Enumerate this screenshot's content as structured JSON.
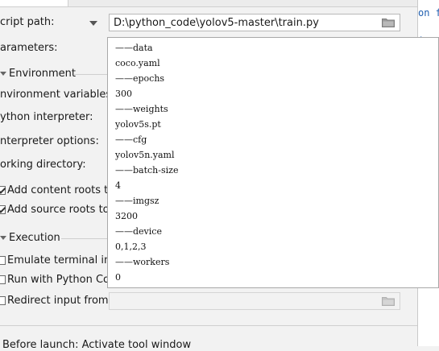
{
  "form": {
    "script_path_label": "cript path:",
    "script_path_value": "D:\\python_code\\yolov5-master\\train.py",
    "parameters_label": "arameters:",
    "environment_section": "Environment",
    "env_vars_label": "nvironment variables:",
    "python_interpreter_label": "ython interpreter:",
    "interpreter_options_label": "nterpreter options:",
    "working_dir_label": "orking directory:",
    "add_content_roots_label": "Add content roots to",
    "add_source_roots_label": "Add source roots to P",
    "execution_section": "Execution",
    "emulate_terminal_label": "Emulate terminal in ou",
    "run_python_console_label": "Run with Python Cons",
    "redirect_input_label": "Redirect input from:",
    "before_launch_label": "Before launch: Activate tool window"
  },
  "editor": {
    "code_lines": [
      "on f",
      "",
      ":"
    ]
  },
  "parameters_popup": {
    "lines": [
      "——data",
      "coco.yaml",
      "——epochs",
      "300",
      "——weights",
      "yolov5s.pt",
      "——cfg",
      "yolov5n.yaml",
      "——batch-size",
      "4",
      "——imgsz",
      "3200",
      "——device",
      "0,1,2,3",
      "——workers",
      "0"
    ]
  },
  "icons": {
    "dropdown": "chevron-down-icon",
    "browse": "folder-icon",
    "section": "collapse-triangle-icon"
  }
}
